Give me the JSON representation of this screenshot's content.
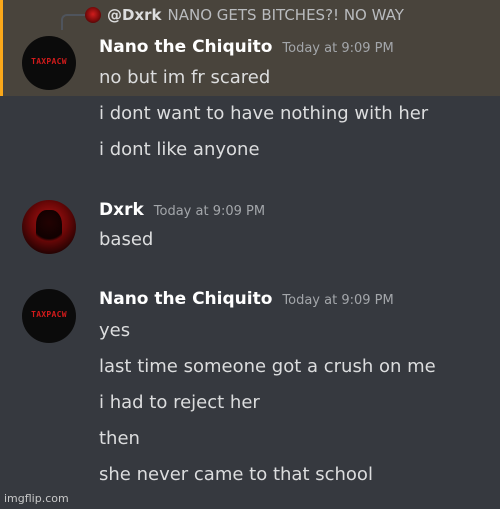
{
  "reply": {
    "author": "@Dxrk",
    "text": "NANO GETS BITCHES?! NO WAY"
  },
  "messages": [
    {
      "author": "Nano the Chiquito",
      "timestamp": "Today at 9:09 PM",
      "avatar_text": "TAXPACW",
      "lines": [
        "no but im fr scared",
        "i dont want to have nothing with her",
        "i dont like anyone"
      ]
    },
    {
      "author": "Dxrk",
      "timestamp": "Today at 9:09 PM",
      "lines": [
        "based"
      ]
    },
    {
      "author": "Nano the Chiquito",
      "timestamp": "Today at 9:09 PM",
      "avatar_text": "TAXPACW",
      "lines": [
        "yes",
        "last time someone got a crush on me",
        "i had to reject her",
        "then",
        "she never came to that school"
      ]
    }
  ],
  "watermark": "imgflip.com",
  "colors": {
    "background": "#36393f",
    "highlight": "#49443c",
    "highlight_border": "#faa81a",
    "username": "#ffffff",
    "message_text": "#dcddde",
    "timestamp": "#a3a6aa"
  }
}
